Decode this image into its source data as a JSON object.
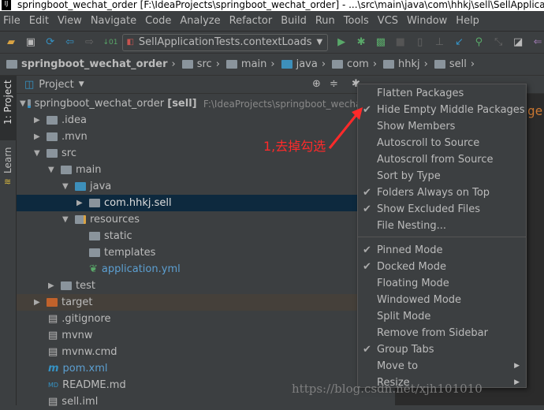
{
  "window": {
    "title": "springboot_wechat_order [F:\\IdeaProjects\\springboot_wechat_order] - ...\\src\\main\\java\\com\\hhkj\\sell\\SellApplicationTests.java"
  },
  "menubar": [
    "File",
    "Edit",
    "View",
    "Navigate",
    "Code",
    "Analyze",
    "Refactor",
    "Build",
    "Run",
    "Tools",
    "VCS",
    "Window",
    "Help"
  ],
  "toolbar": {
    "run_config": "SellApplicationTests.contextLoads"
  },
  "breadcrumb": [
    "springboot_wechat_order",
    "src",
    "main",
    "java",
    "com",
    "hhkj",
    "sell"
  ],
  "sidestrip": {
    "project": "1: Project",
    "learn": "Learn"
  },
  "panel": {
    "title": "Project",
    "tree": [
      {
        "label": "springboot_wechat_order",
        "module": "[sell]",
        "path": "F:\\IdeaProjects\\springboot_wechat_order"
      },
      {
        "label": ".idea"
      },
      {
        "label": ".mvn"
      },
      {
        "label": "src"
      },
      {
        "label": "main"
      },
      {
        "label": "java"
      },
      {
        "label": "com.hhkj.sell"
      },
      {
        "label": "resources"
      },
      {
        "label": "static"
      },
      {
        "label": "templates"
      },
      {
        "label": "application.yml"
      },
      {
        "label": "test"
      },
      {
        "label": "target"
      },
      {
        "label": ".gitignore"
      },
      {
        "label": "mvnw"
      },
      {
        "label": "mvnw.cmd"
      },
      {
        "label": "pom.xml"
      },
      {
        "label": "README.md"
      },
      {
        "label": "sell.iml"
      }
    ]
  },
  "menu": {
    "items": [
      {
        "label": "Flatten Packages",
        "checked": false
      },
      {
        "label": "Hide Empty Middle Packages",
        "checked": true
      },
      {
        "label": "Show Members",
        "checked": false
      },
      {
        "label": "Autoscroll to Source",
        "checked": false
      },
      {
        "label": "Autoscroll from Source",
        "checked": false
      },
      {
        "label": "Sort by Type",
        "checked": false
      },
      {
        "label": "Folders Always on Top",
        "checked": true
      },
      {
        "label": "Show Excluded Files",
        "checked": true
      },
      {
        "label": "File Nesting...",
        "checked": false
      },
      {
        "label": "Pinned Mode",
        "checked": true
      },
      {
        "label": "Docked Mode",
        "checked": true
      },
      {
        "label": "Floating Mode",
        "checked": false
      },
      {
        "label": "Windowed Mode",
        "checked": false
      },
      {
        "label": "Split Mode",
        "checked": false
      },
      {
        "label": "Remove from Sidebar",
        "checked": false
      },
      {
        "label": "Group Tabs",
        "checked": true
      },
      {
        "label": "Move to",
        "checked": false,
        "submenu": true
      },
      {
        "label": "Resize",
        "checked": false,
        "submenu": true
      }
    ]
  },
  "annotation": "1,去掉勾选",
  "watermark": "https://blog.csdn.net/xjh101010",
  "colors": {
    "selection": "#0d293e",
    "target_row": "#45403a",
    "annotation": "#ff2a2a",
    "accent": "#3592c4"
  }
}
